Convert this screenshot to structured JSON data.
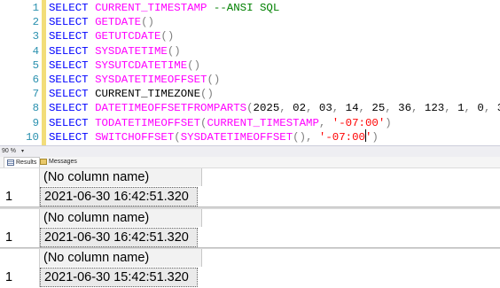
{
  "editor": {
    "lines": [
      {
        "num": "1",
        "parts": [
          [
            "kw",
            "SELECT "
          ],
          [
            "fn",
            "CURRENT_TIMESTAMP"
          ],
          [
            "txt",
            " "
          ],
          [
            "cm",
            "--ANSI SQL"
          ]
        ]
      },
      {
        "num": "2",
        "parts": [
          [
            "kw",
            "SELECT "
          ],
          [
            "fn",
            "GETDATE"
          ],
          [
            "gr",
            "()"
          ]
        ]
      },
      {
        "num": "3",
        "parts": [
          [
            "kw",
            "SELECT "
          ],
          [
            "fn",
            "GETUTCDATE"
          ],
          [
            "gr",
            "()"
          ]
        ]
      },
      {
        "num": "4",
        "parts": [
          [
            "kw",
            "SELECT "
          ],
          [
            "fn",
            "SYSDATETIME"
          ],
          [
            "gr",
            "()"
          ]
        ]
      },
      {
        "num": "5",
        "parts": [
          [
            "kw",
            "SELECT "
          ],
          [
            "fn",
            "SYSUTCDATETIME"
          ],
          [
            "gr",
            "()"
          ]
        ]
      },
      {
        "num": "6",
        "parts": [
          [
            "kw",
            "SELECT "
          ],
          [
            "fn",
            "SYSDATETIMEOFFSET"
          ],
          [
            "gr",
            "()"
          ]
        ]
      },
      {
        "num": "7",
        "parts": [
          [
            "kw",
            "SELECT "
          ],
          [
            "txt",
            "CURRENT_TIMEZONE"
          ],
          [
            "gr",
            "()"
          ]
        ]
      },
      {
        "num": "8",
        "parts": [
          [
            "kw",
            "SELECT "
          ],
          [
            "fn",
            "DATETIMEOFFSETFROMPARTS"
          ],
          [
            "gr",
            "("
          ],
          [
            "txt",
            "2025"
          ],
          [
            "gr",
            ", "
          ],
          [
            "txt",
            "02"
          ],
          [
            "gr",
            ", "
          ],
          [
            "txt",
            "03"
          ],
          [
            "gr",
            ", "
          ],
          [
            "txt",
            "14"
          ],
          [
            "gr",
            ", "
          ],
          [
            "txt",
            "25"
          ],
          [
            "gr",
            ", "
          ],
          [
            "txt",
            "36"
          ],
          [
            "gr",
            ", "
          ],
          [
            "txt",
            "123"
          ],
          [
            "gr",
            ", "
          ],
          [
            "txt",
            "1"
          ],
          [
            "gr",
            ", "
          ],
          [
            "txt",
            "0"
          ],
          [
            "gr",
            ", "
          ],
          [
            "txt",
            "3"
          ],
          [
            "gr",
            ")"
          ]
        ]
      },
      {
        "num": "9",
        "parts": [
          [
            "kw",
            "SELECT "
          ],
          [
            "fn",
            "TODATETIMEOFFSET"
          ],
          [
            "gr",
            "("
          ],
          [
            "fn",
            "CURRENT_TIMESTAMP"
          ],
          [
            "gr",
            ", "
          ],
          [
            "str",
            "'-07:00'"
          ],
          [
            "gr",
            ")"
          ]
        ]
      },
      {
        "num": "10",
        "parts": [
          [
            "kw",
            "SELECT "
          ],
          [
            "fn",
            "SWITCHOFFSET"
          ],
          [
            "gr",
            "("
          ],
          [
            "fn",
            "SYSDATETIMEOFFSET"
          ],
          [
            "gr",
            "(), "
          ],
          [
            "str",
            "'-07:00'"
          ],
          [
            "gr",
            ")"
          ]
        ]
      }
    ]
  },
  "zoom": {
    "value": "90 %"
  },
  "tabs": {
    "results": "Results",
    "messages": "Messages"
  },
  "results": [
    {
      "header": "(No column name)",
      "row_num": "1",
      "value": "2021-06-30 16:42:51.320"
    },
    {
      "header": "(No column name)",
      "row_num": "1",
      "value": "2021-06-30 16:42:51.320"
    },
    {
      "header": "(No column name)",
      "row_num": "1",
      "value": "2021-06-30 15:42:51.320"
    }
  ],
  "colors": {
    "keyword": "#0000ff",
    "function": "#ff00ff",
    "punctuation": "#808080",
    "string": "#ff0000",
    "comment": "#008000",
    "line_number": "#2b91af",
    "change_bar": "#f2dd7a"
  }
}
